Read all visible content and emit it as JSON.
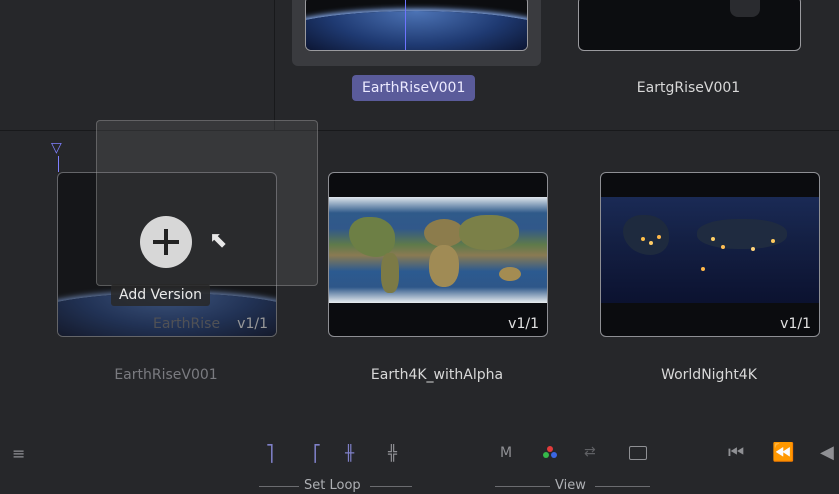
{
  "top_clips": [
    {
      "name": "EarthRiseV001",
      "selected": true
    },
    {
      "name": "EartgRiseV001",
      "selected": false
    }
  ],
  "drag": {
    "tooltip": "Add Version",
    "ghost_text": "EarthRise"
  },
  "bottom_clips": [
    {
      "name": "EarthRiseV001",
      "version": "v1/1",
      "dimmed": true
    },
    {
      "name": "Earth4K_withAlpha",
      "version": "v1/1",
      "dimmed": false
    },
    {
      "name": "WorldNight4K",
      "version": "v1/1",
      "dimmed": false
    }
  ],
  "toolbar": {
    "menu_glyph": "≡",
    "set_loop_label": "Set Loop",
    "view_label": "View",
    "m_label": "M",
    "playback_first": "⏮",
    "playback_rewind": "⏪",
    "playback_prev": "◀"
  },
  "colors": {
    "accent": "#7f80c8",
    "selected_pill": "#5a5b9a"
  }
}
